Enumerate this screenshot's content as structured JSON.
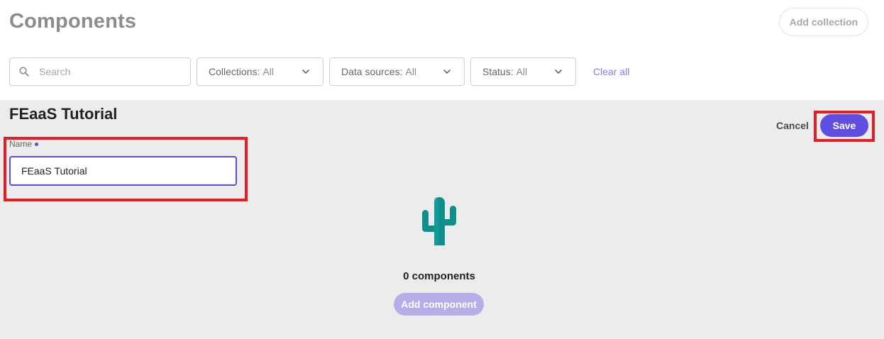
{
  "header": {
    "title": "Components",
    "add_collection_label": "Add collection"
  },
  "filters": {
    "search_placeholder": "Search",
    "collections_label": "Collections:",
    "collections_value": "All",
    "data_sources_label": "Data sources:",
    "data_sources_value": "All",
    "status_label": "Status:",
    "status_value": "All",
    "clear_all_label": "Clear all"
  },
  "collection": {
    "title": "FEaaS Tutorial",
    "cancel_label": "Cancel",
    "save_label": "Save",
    "name_label": "Name",
    "name_value": "FEaaS Tutorial",
    "empty_count": "0 components",
    "add_component_label": "Add component"
  },
  "icons": {
    "search": "search-icon",
    "chevron": "chevron-down-icon",
    "empty": "cactus-icon"
  },
  "colors": {
    "accent": "#5e4fe0",
    "accent_muted": "#b6aee8",
    "link": "#8a7ce6",
    "highlight": "#e31e24",
    "cactus": "#0f8f8c"
  }
}
